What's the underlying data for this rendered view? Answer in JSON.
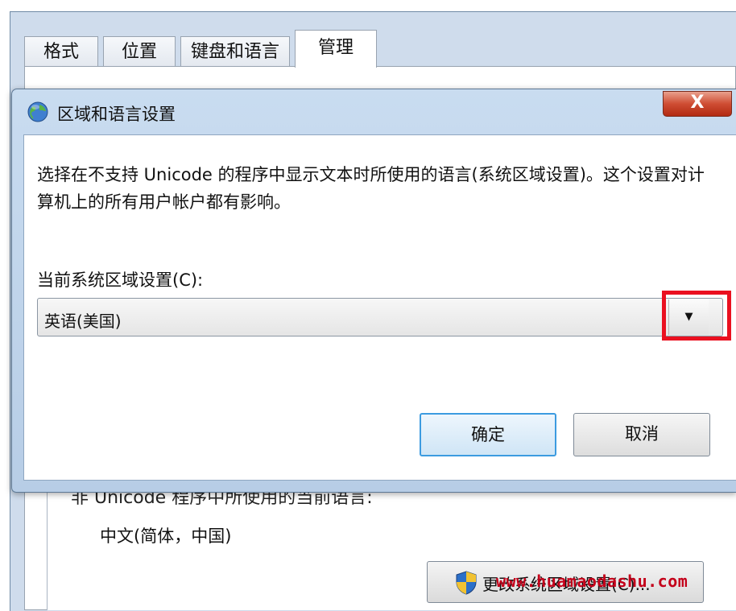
{
  "background_window": {
    "tabs": [
      "格式",
      "位置",
      "键盘和语言",
      "管理"
    ],
    "active_tab": "管理",
    "non_unicode_label": "非 Unicode 程序中所使用的当前语言:",
    "current_language": "中文(简体，中国)",
    "change_button_label": "更改系统区域设置(C)..."
  },
  "dialog": {
    "title": "区域和语言设置",
    "close_label": "X",
    "description": "选择在不支持 Unicode 的程序中显示文本时所使用的语言(系统区域设置)。这个设置对计算机上的所有用户帐户都有影响。",
    "combo_label": "当前系统区域设置(C):",
    "combo_value": "英语(美国)",
    "combo_arrow": "▼",
    "ok_label": "确定",
    "cancel_label": "取消"
  },
  "watermark": "www.huamaodashu.com",
  "colors": {
    "highlight": "#ea1020",
    "title_gradient": "#c9dcf0",
    "close_button": "#cf4d33",
    "ok_border": "#3c9be0",
    "watermark": "#c4001a"
  },
  "icons": [
    "globe-icon",
    "shield-icon"
  ]
}
